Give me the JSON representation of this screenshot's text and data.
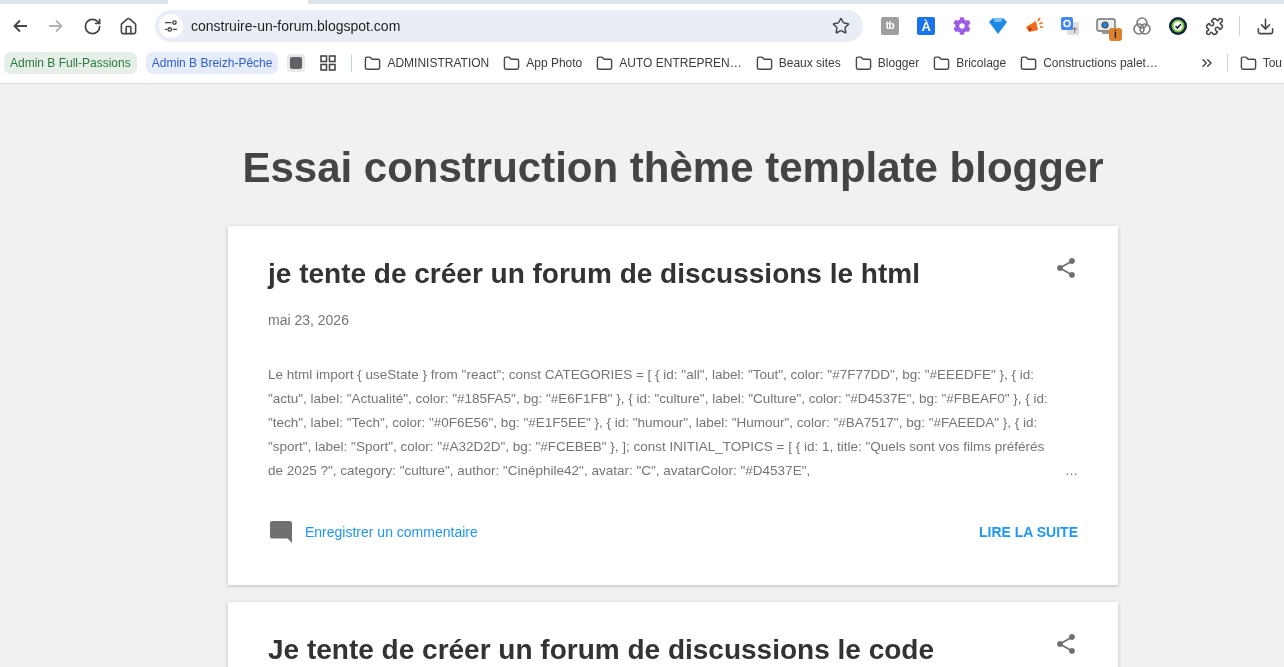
{
  "browser": {
    "nav_buttons": [
      {
        "kind": "back",
        "disabled": false
      },
      {
        "kind": "forward",
        "disabled": true
      },
      {
        "kind": "reload",
        "disabled": false
      },
      {
        "kind": "home",
        "disabled": false
      }
    ],
    "address_bar": {
      "url": "construire-un-forum.blogspot.com"
    },
    "extensions": [
      {
        "kind": "tile",
        "glyph": "tb",
        "color": "#9e9e9e"
      },
      {
        "kind": "tile",
        "glyph": "À",
        "color": "#1a73e8"
      },
      {
        "kind": "gear"
      },
      {
        "kind": "diamond"
      },
      {
        "kind": "megaphone"
      },
      {
        "kind": "translate"
      },
      {
        "kind": "screen",
        "badge": "i"
      },
      {
        "kind": "rings"
      },
      {
        "kind": "check"
      }
    ],
    "bookmarks": [
      {
        "kind": "group",
        "label": "Admin B Full-Passions",
        "color": "#2a7a3f"
      },
      {
        "kind": "group",
        "label": "Admin B Breizh-Pêche",
        "color": "#2f5fd0"
      },
      {
        "kind": "favicon"
      },
      {
        "kind": "apps"
      },
      {
        "kind": "separator"
      },
      {
        "kind": "folder",
        "label": "ADMINISTRATION"
      },
      {
        "kind": "folder",
        "label": "App Photo"
      },
      {
        "kind": "folder",
        "label": "AUTO ENTREPREN…"
      },
      {
        "kind": "folder",
        "label": "Beaux sites"
      },
      {
        "kind": "folder",
        "label": "Blogger"
      },
      {
        "kind": "folder",
        "label": "Bricolage"
      },
      {
        "kind": "folder",
        "label": "Constructions palet…"
      },
      {
        "kind": "overflow"
      },
      {
        "kind": "separator"
      },
      {
        "kind": "folder",
        "label": "Tou"
      }
    ]
  },
  "blog": {
    "title": "Essai construction thème template blogger",
    "posts": [
      {
        "title": "je tente de créer un forum de discussions le html",
        "date": "mai 23, 2026",
        "snippet": "Le html import { useState } from \"react\"; const CATEGORIES = [ { id: \"all\", label: \"Tout\", color: \"#7F77DD\", bg: \"#EEEDFE\" }, { id: \"actu\", label: \"Actualité\", color: \"#185FA5\", bg: \"#E6F1FB\" }, { id: \"culture\", label: \"Culture\", color: \"#D4537E\", bg: \"#FBEAF0\" }, { id: \"tech\", label: \"Tech\", color: \"#0F6E56\", bg: \"#E1F5EE\" }, { id: \"humour\", label: \"Humour\", color: \"#BA7517\", bg: \"#FAEEDA\" }, { id: \"sport\", label: \"Sport\", color: \"#A32D2D\", bg: \"#FCEBEB\" }, ]; const INITIAL_TOPICS = [ { id: 1, title: \"Quels sont vos films préférés de 2025 ?\", category: \"culture\", author: \"Cinéphile42\", avatar: \"C\", avatarColor: \"#D4537E\",",
        "snippet_more": "…",
        "comment_link": "Enregistrer un commentaire",
        "read_more": "LIRE LA SUITE"
      },
      {
        "title": "Je tente de créer un forum de discussions le code"
      }
    ]
  }
}
